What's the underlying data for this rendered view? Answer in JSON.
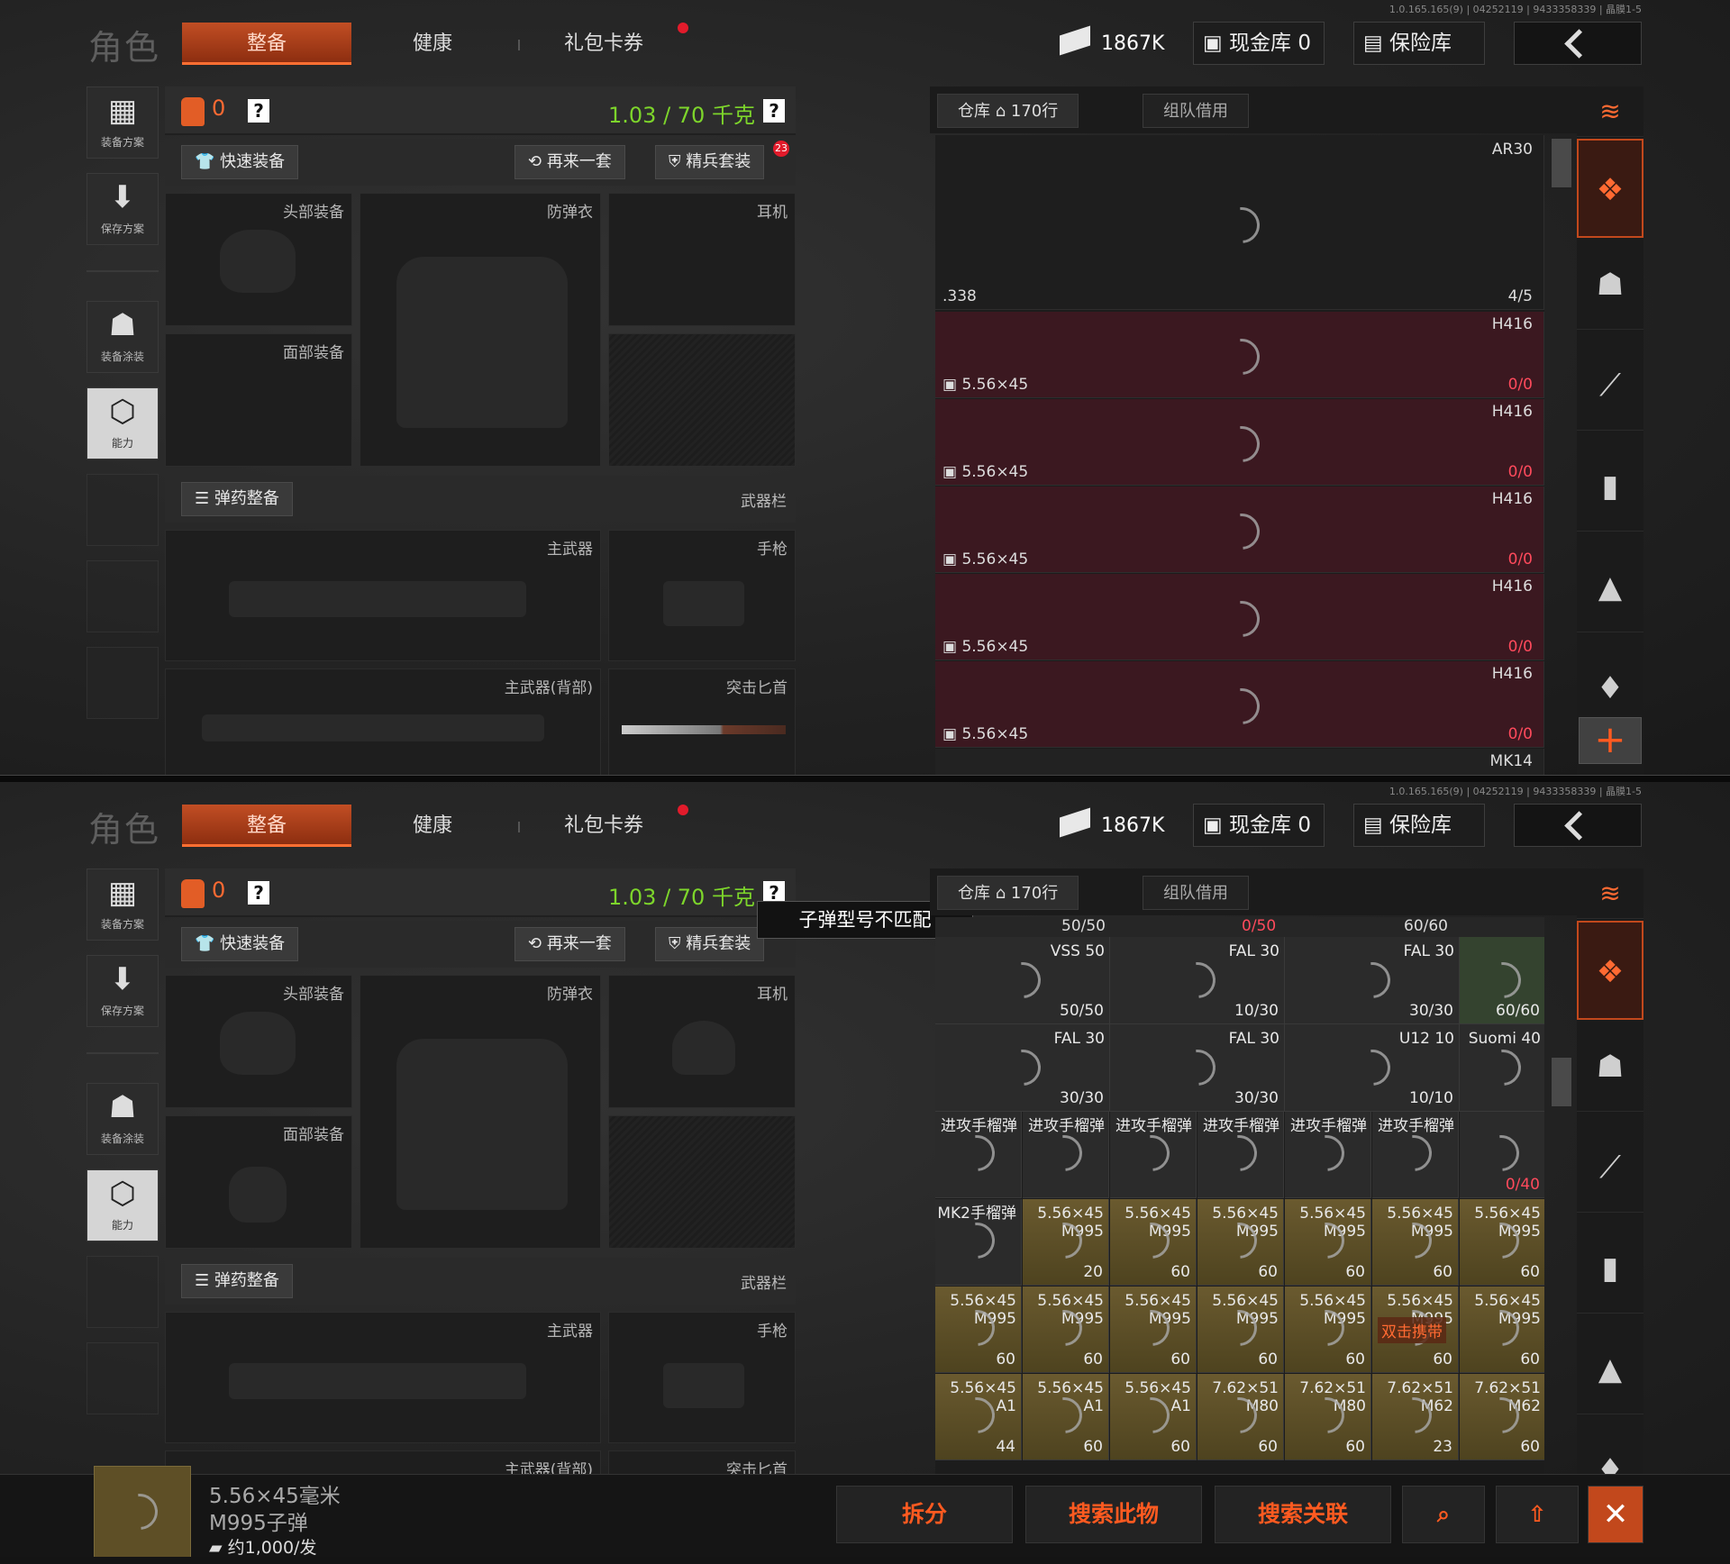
{
  "version": "1.0.165.165(9) | 04252119 | 9433358339 | 晶膜1-5",
  "title": "角色",
  "tabs": {
    "equip": "整备",
    "health": "健康",
    "gift": "礼包卡券"
  },
  "currency": "1867K",
  "cash_vault": "现金库 0",
  "insurance": "保险库",
  "sidebar": {
    "plan": "装备方案",
    "save": "保存方案",
    "paint": "装备涂装",
    "ability": "能力"
  },
  "loadout": {
    "bag_count": "0",
    "help": "?",
    "weight": "1.03 / 70 千克",
    "quick_equip": "快速装备",
    "again": "再来一套",
    "elite": "精兵套装",
    "elite_badge": "23",
    "head": "头部装备",
    "armor": "防弹衣",
    "earphone": "耳机",
    "face": "面部装备",
    "ammo_equip": "弹药整备",
    "weapon_bar": "武器栏",
    "primary": "主武器",
    "pistol": "手枪",
    "primary_back": "主武器(背部)",
    "dagger": "突击匕首"
  },
  "warehouse": {
    "tab": "仓库",
    "rows": "170行",
    "team": "组队借用"
  },
  "p1_items": {
    "ar30": "AR30",
    "cal338": ".338",
    "count45": "4/5",
    "h416": "H416",
    "ammo": "5.56×45",
    "zero": "0/0",
    "mk14": "MK14"
  },
  "p2": {
    "tooltip": "子弹型号不匹配",
    "top_counts": [
      "50/50",
      "0/50",
      "60/60"
    ],
    "rows": [
      [
        {
          "t": "VSS 50",
          "n": "50/50",
          "c": "gray"
        },
        {
          "t": "FAL 30",
          "n": "10/30",
          "c": "gray"
        },
        {
          "t": "FAL 30",
          "n": "30/30",
          "c": "gray"
        },
        {
          "t": "",
          "n": "60/60",
          "c": "green"
        }
      ],
      [
        {
          "t": "FAL 30",
          "n": "30/30",
          "c": "gray"
        },
        {
          "t": "FAL 30",
          "n": "30/30",
          "c": "gray"
        },
        {
          "t": "U12 10",
          "n": "10/10",
          "c": "gray"
        },
        {
          "t": "Suomi 40",
          "n": "",
          "c": "gray"
        }
      ]
    ],
    "grenade": "进攻手榴弹",
    "mk2": "MK2手榴弹",
    "suomi_count": "0/40",
    "ammo_rows": [
      [
        {
          "t": "5.56×45\nM995",
          "n": "20"
        },
        {
          "t": "5.56×45\nM995",
          "n": "60"
        },
        {
          "t": "5.56×45\nM995",
          "n": "60"
        },
        {
          "t": "5.56×45\nM995",
          "n": "60"
        },
        {
          "t": "5.56×45\nM995",
          "n": "60"
        },
        {
          "t": "5.56×45\nM995",
          "n": "60"
        }
      ],
      [
        {
          "t": "5.56×45\nM995",
          "n": "60"
        },
        {
          "t": "5.56×45\nM995",
          "n": "60"
        },
        {
          "t": "5.56×45\nM995",
          "n": "60"
        },
        {
          "t": "5.56×45\nM995",
          "n": "60"
        },
        {
          "t": "5.56×45\nM995",
          "n": "60"
        },
        {
          "t": "5.56×45\nM995",
          "n": "60"
        },
        {
          "t": "5.56×45\nM995",
          "n": "60"
        }
      ],
      [
        {
          "t": "5.56×45\nA1",
          "n": "44"
        },
        {
          "t": "5.56×45\nA1",
          "n": "60"
        },
        {
          "t": "5.56×45\nA1",
          "n": "60"
        },
        {
          "t": "7.62×51\nM80",
          "n": "60"
        },
        {
          "t": "7.62×51\nM80",
          "n": "60"
        },
        {
          "t": "7.62×51\nM62",
          "n": "23"
        },
        {
          "t": "7.62×51\nM62",
          "n": "60"
        }
      ]
    ],
    "double_click": "双击携带",
    "selected": {
      "name1": "5.56×45毫米",
      "name2": "M995子弹",
      "price": "约1,000/发"
    },
    "actions": {
      "split": "拆分",
      "search": "搜索此物",
      "related": "搜索关联"
    }
  },
  "colors": {
    "accent": "#ff6a32",
    "weight": "#7dd52b",
    "red_row": "#3b1820",
    "gold_cell": "#6a5a2f"
  }
}
